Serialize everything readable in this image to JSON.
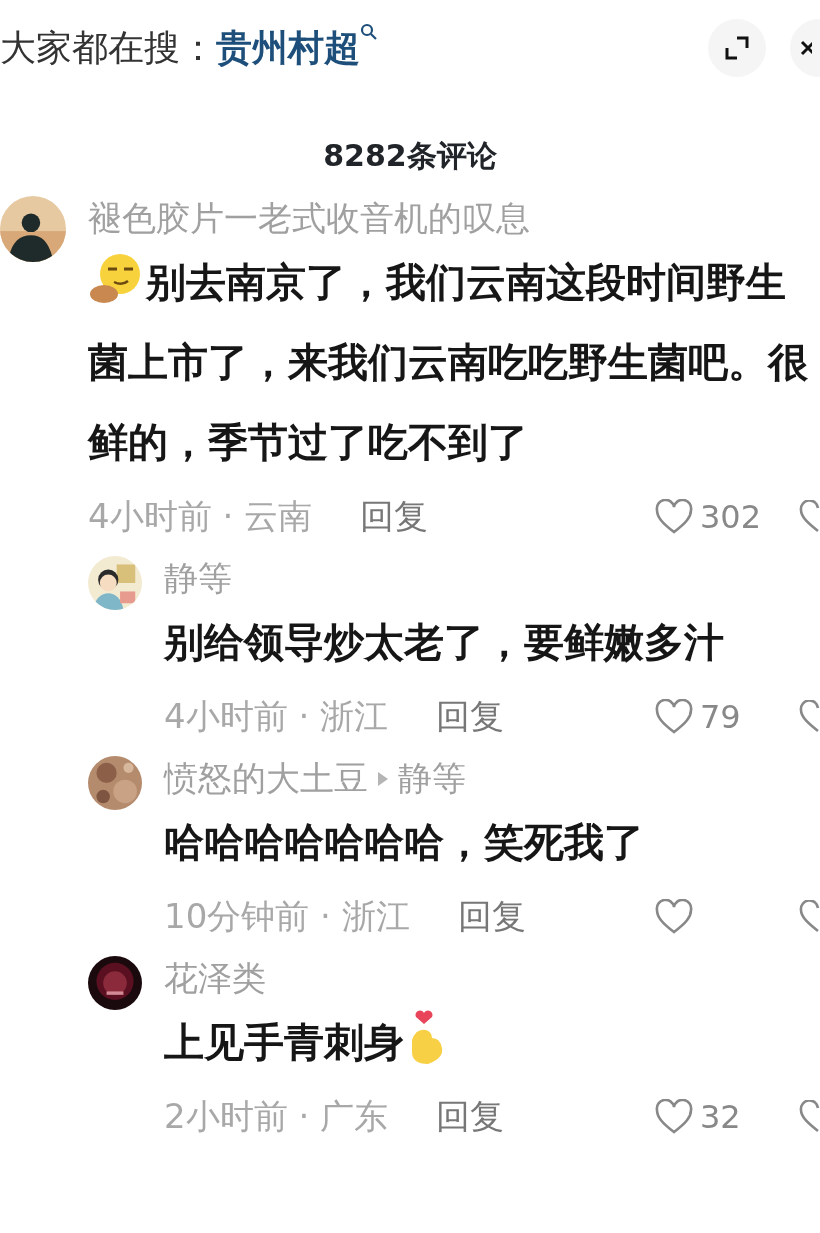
{
  "search_bar": {
    "label": "大家都在搜：",
    "query": "贵州村超"
  },
  "header": {
    "title": "8282条评论"
  },
  "comments": [
    {
      "user": "褪色胶片一老式收音机的叹息",
      "emoji_before": true,
      "text": "别去南京了，我们云南这段时间野生菌上市了，来我们云南吃吃野生菌吧。很鲜的，季节过了吃不到了",
      "meta": "4小时前 · 云南",
      "reply": "回复",
      "likes": "302",
      "liked": false,
      "replies": [
        {
          "user": "静等",
          "text": "别给领导炒太老了，要鲜嫩多汁",
          "meta": "4小时前 · 浙江",
          "reply": "回复",
          "likes": "79",
          "liked": false
        },
        {
          "user": "愤怒的大土豆",
          "reply_to": "静等",
          "text": "哈哈哈哈哈哈哈，笑死我了",
          "meta": "10分钟前 · 浙江",
          "reply": "回复",
          "liked": false
        },
        {
          "user": "花泽类",
          "text": "上见手青刺身",
          "emoji_after": true,
          "meta": "2小时前 · 广东",
          "reply": "回复",
          "likes": "32",
          "liked": false
        }
      ]
    }
  ]
}
